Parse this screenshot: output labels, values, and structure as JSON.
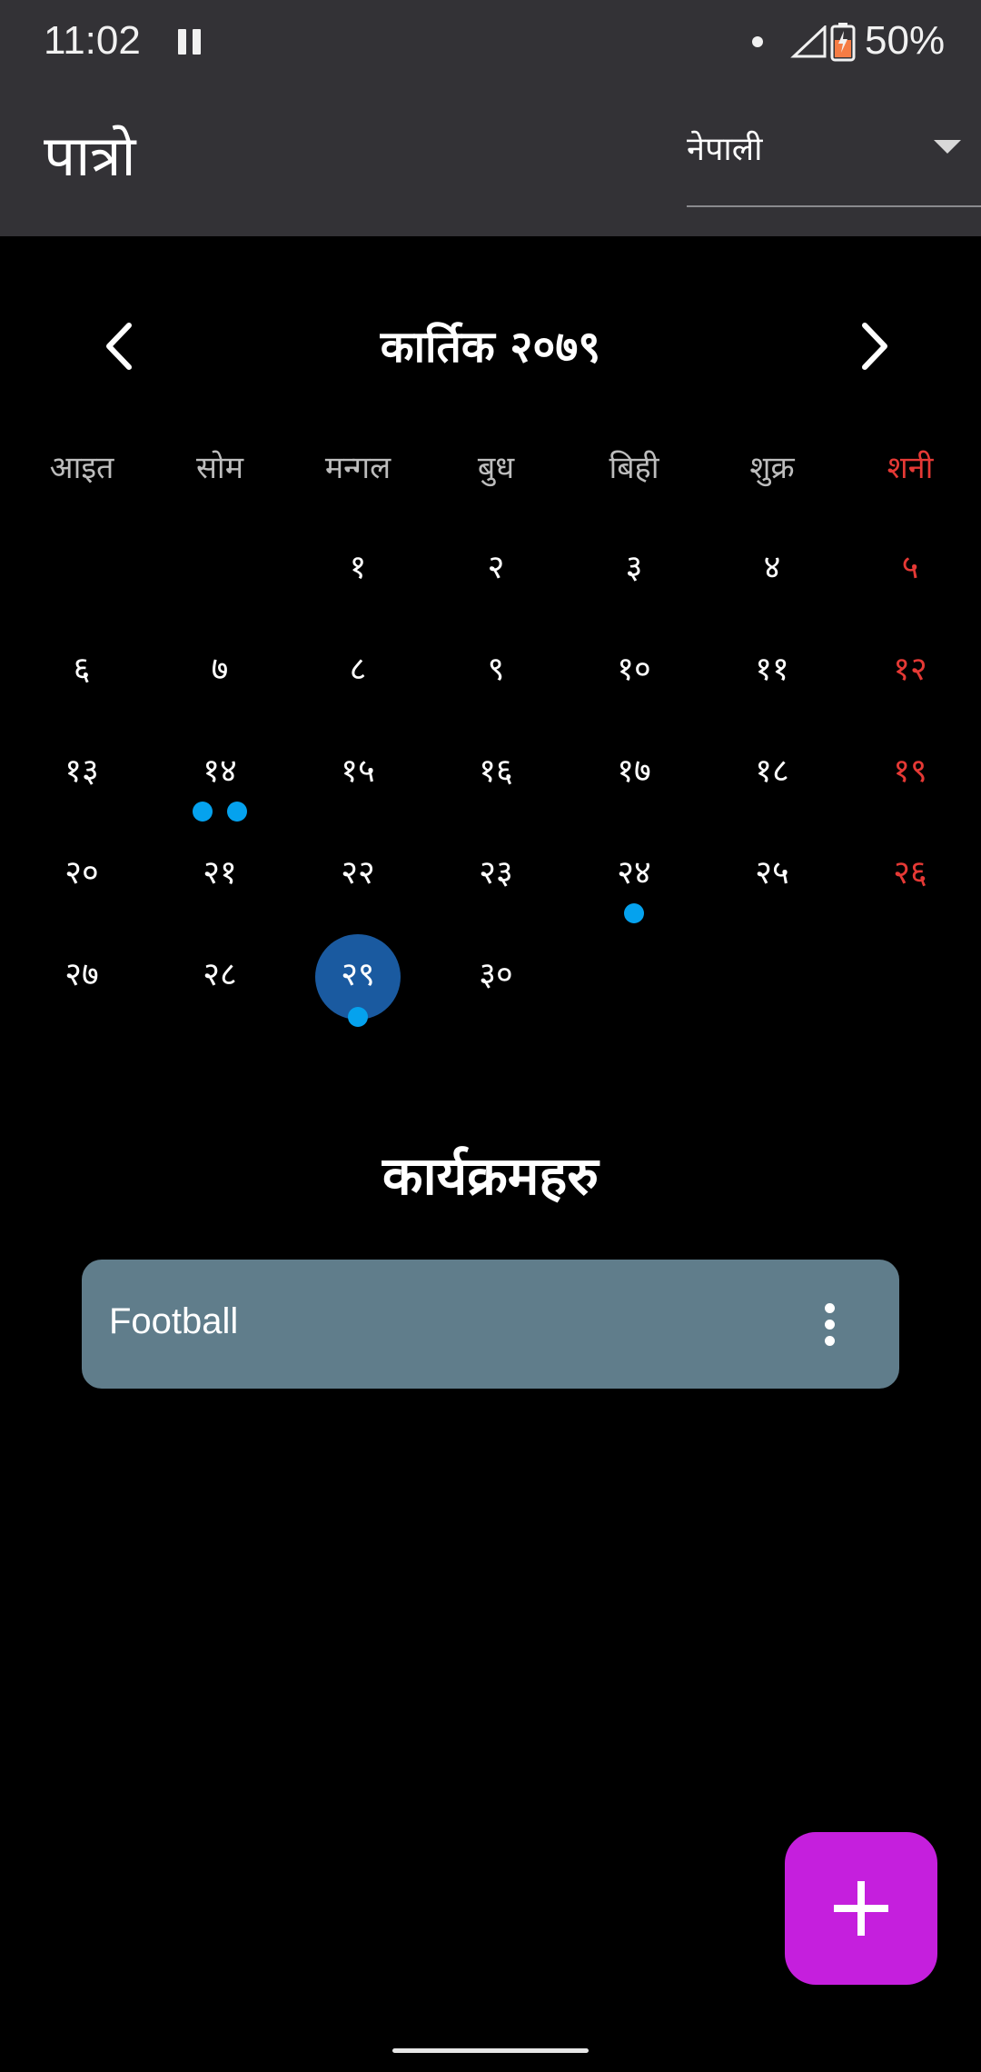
{
  "status_bar": {
    "time": "11:02",
    "battery": "50%",
    "icons": [
      "pause-icon",
      "dot-icon",
      "signal-icon",
      "battery-icon"
    ]
  },
  "app_bar": {
    "title": "पात्रो",
    "language_select": {
      "value": "नेपाली"
    }
  },
  "calendar": {
    "month_title": "कार्तिक २०७९",
    "weekdays": [
      "आइत",
      "सोम",
      "मन्गल",
      "बुध",
      "बिही",
      "शुक्र",
      "शनी"
    ],
    "weeks": [
      [
        {
          "label": ""
        },
        {
          "label": ""
        },
        {
          "label": "१"
        },
        {
          "label": "२"
        },
        {
          "label": "३"
        },
        {
          "label": "४"
        },
        {
          "label": "५"
        }
      ],
      [
        {
          "label": "६"
        },
        {
          "label": "७"
        },
        {
          "label": "८"
        },
        {
          "label": "९"
        },
        {
          "label": "१०"
        },
        {
          "label": "११"
        },
        {
          "label": "१२"
        }
      ],
      [
        {
          "label": "१३"
        },
        {
          "label": "१४",
          "events": 2
        },
        {
          "label": "१५"
        },
        {
          "label": "१६"
        },
        {
          "label": "१७"
        },
        {
          "label": "१८"
        },
        {
          "label": "१९"
        }
      ],
      [
        {
          "label": "२०"
        },
        {
          "label": "२१"
        },
        {
          "label": "२२"
        },
        {
          "label": "२३"
        },
        {
          "label": "२४",
          "events": 1
        },
        {
          "label": "२५"
        },
        {
          "label": "२६"
        }
      ],
      [
        {
          "label": "२७"
        },
        {
          "label": "२८"
        },
        {
          "label": "२९",
          "events": 1,
          "selected": true
        },
        {
          "label": "३०"
        },
        {
          "label": ""
        },
        {
          "label": ""
        },
        {
          "label": ""
        }
      ]
    ],
    "colors": {
      "weekday": "#bdbdbd",
      "saturday": "#e53935",
      "selected": "#1a5aa0",
      "event_dot": "#05a2ee"
    }
  },
  "events": {
    "heading": "कार्यक्रमहरु",
    "items": [
      {
        "title": "Football"
      }
    ]
  },
  "fab": {
    "icon": "plus-icon",
    "color": "#c51fdd"
  }
}
